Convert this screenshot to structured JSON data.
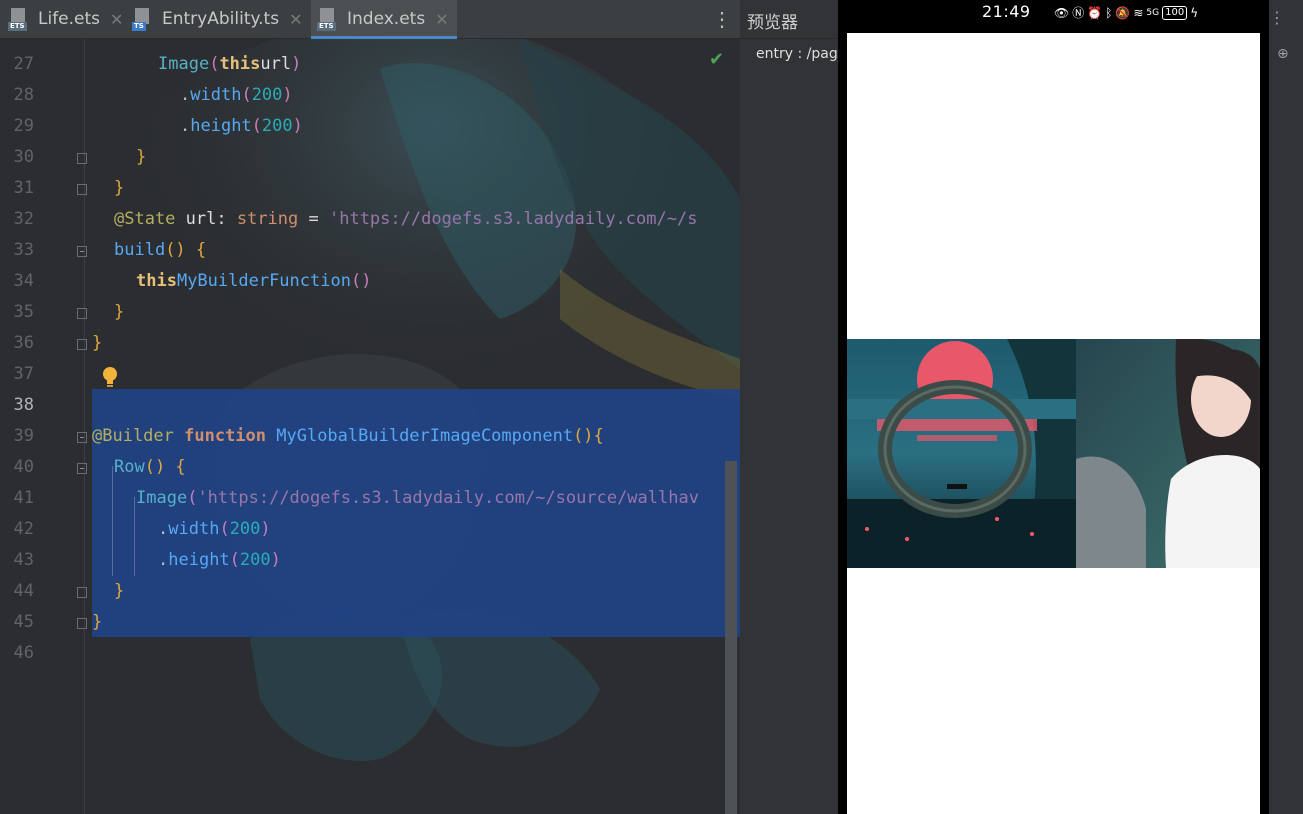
{
  "tabs": [
    {
      "label": "Life.ets",
      "badge": "ETS",
      "badge_color": "#5a6d7f",
      "close": "✕"
    },
    {
      "label": "EntryAbility.ts",
      "badge": "TS",
      "badge_color": "#3c7cc6",
      "close": "✕"
    },
    {
      "label": "Index.ets",
      "badge": "ETS",
      "badge_color": "#5a6d7f",
      "close": "✕",
      "active": true
    }
  ],
  "menu_icon": "more-vertical-icon",
  "editor": {
    "line_numbers": [
      "27",
      "28",
      "29",
      "30",
      "31",
      "32",
      "33",
      "34",
      "35",
      "36",
      "37",
      "38",
      "39",
      "40",
      "41",
      "42",
      "43",
      "44",
      "45",
      "46"
    ],
    "current_line": "38",
    "lines": {
      "l27": {
        "a": "Image",
        "b": "(",
        "c": "this",
        ".": ".",
        "d": "url",
        "e": ")"
      },
      "l28": {
        "a": ".",
        "b": "width",
        "c": "(",
        "d": "200",
        "e": ")"
      },
      "l29": {
        "a": ".",
        "b": "height",
        "c": "(",
        "d": "200",
        "e": ")"
      },
      "l30": "}",
      "l31": "}",
      "l32": {
        "a": "@State",
        "b": " url: ",
        "c": "string",
        "d": " = ",
        "e": "'https://dogefs.s3.ladydaily.com/~/s"
      },
      "l33": {
        "a": "build",
        "b": "() {"
      },
      "l34": {
        "a": "this",
        ".": ".",
        "b": "MyBuilderFunction",
        "c": "()"
      },
      "l35": "}",
      "l36": "}",
      "l39": {
        "a": "@Builder",
        "b": " function ",
        "c": "MyGlobalBuilderImageComponent",
        "d": "(){"
      },
      "l40": {
        "a": "Row",
        "b": "() {"
      },
      "l41": {
        "a": "Image",
        "b": "(",
        "c": "'https://dogefs.s3.ladydaily.com/~/source/wallhav"
      },
      "l42": {
        "a": ".",
        "b": "width",
        "c": "(",
        "d": "200",
        "e": ")"
      },
      "l43": {
        "a": ".",
        "b": "height",
        "c": "(",
        "d": "200",
        "e": ")"
      },
      "l44": "}",
      "l45": "}"
    }
  },
  "preview": {
    "title": "预览器",
    "path": "entry : /pages",
    "status_time": "21:49",
    "status_icons": [
      "eye-icon",
      "nfc-icon",
      "alarm-icon",
      "bluetooth-icon",
      "mute-icon",
      "wifi-icon",
      "signal-5g-icon"
    ],
    "signal_label": "5G",
    "battery": "100"
  }
}
